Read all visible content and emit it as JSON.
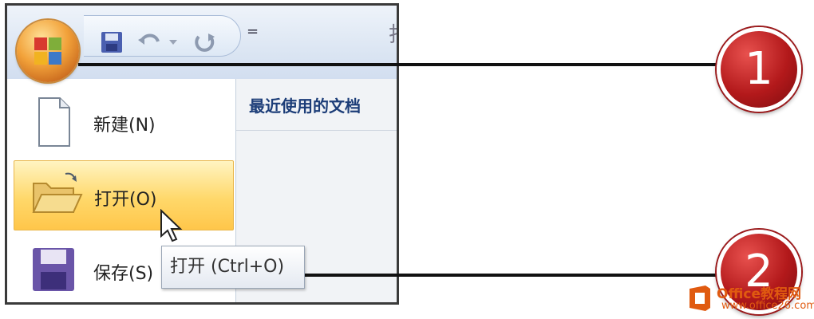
{
  "quick_access": {
    "title_fragment": "打",
    "more_glyph": "="
  },
  "menu": {
    "items": [
      {
        "label": "新建(N)",
        "icon": "new-document-icon"
      },
      {
        "label": "打开(O)",
        "icon": "open-folder-icon"
      },
      {
        "label": "保存(S)",
        "icon": "save-disk-icon"
      }
    ],
    "recent_title": "最近使用的文档"
  },
  "tooltip": {
    "text": "打开 (Ctrl+O)"
  },
  "callouts": [
    {
      "number": "1"
    },
    {
      "number": "2"
    }
  ],
  "watermark": {
    "line1": "Office教程网",
    "line2": "www.office26.com"
  },
  "colors": {
    "hover": "#ffd86a",
    "callout": "#b3191b",
    "accent": "#1c3d78"
  }
}
